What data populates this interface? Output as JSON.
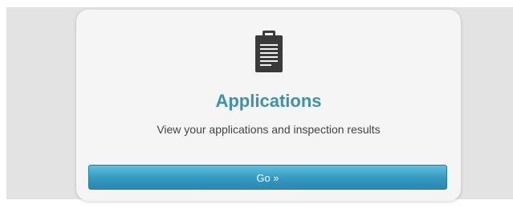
{
  "card": {
    "icon": "clipboard-icon",
    "title": "Applications",
    "description": "View your applications and inspection results",
    "button_label": "Go »"
  },
  "colors": {
    "title": "#3a92ad",
    "button": "#3498c0",
    "card_background": "#f5f5f5",
    "page_background": "#e3e3e3"
  }
}
